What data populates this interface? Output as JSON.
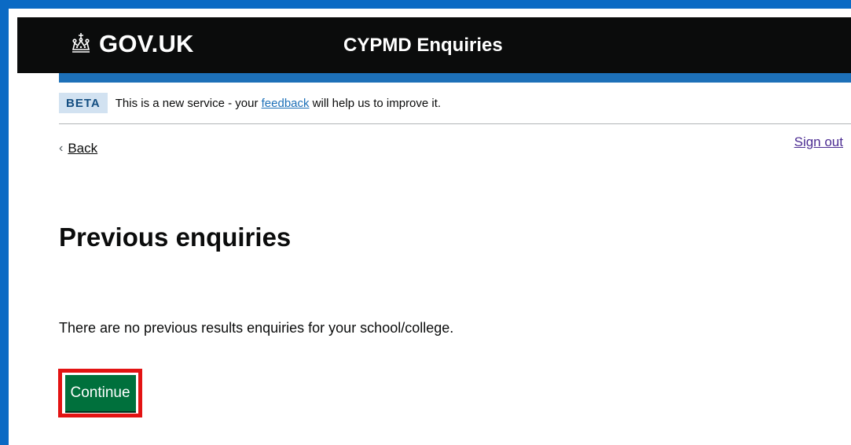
{
  "header": {
    "logo_text": "GOV.UK",
    "logo_icon": "crown-icon",
    "service_name": "CYPMD Enquiries"
  },
  "beta_banner": {
    "tag": "BETA",
    "text_before": "This is a new service - your ",
    "link_text": "feedback",
    "text_after": " will help us to improve it."
  },
  "nav": {
    "back_label": "Back",
    "back_icon": "chevron-left-icon",
    "sign_out_label": "Sign out"
  },
  "main": {
    "title": "Previous enquiries",
    "message": "There are no previous results enquiries for your school/college.",
    "continue_label": "Continue"
  },
  "colors": {
    "header_bg": "#0b0c0c",
    "accent_blue": "#1d70b8",
    "frame_blue": "#0b6ac4",
    "button_green": "#00703c",
    "highlight_red": "#e31313",
    "visited_link": "#4c2c92"
  }
}
